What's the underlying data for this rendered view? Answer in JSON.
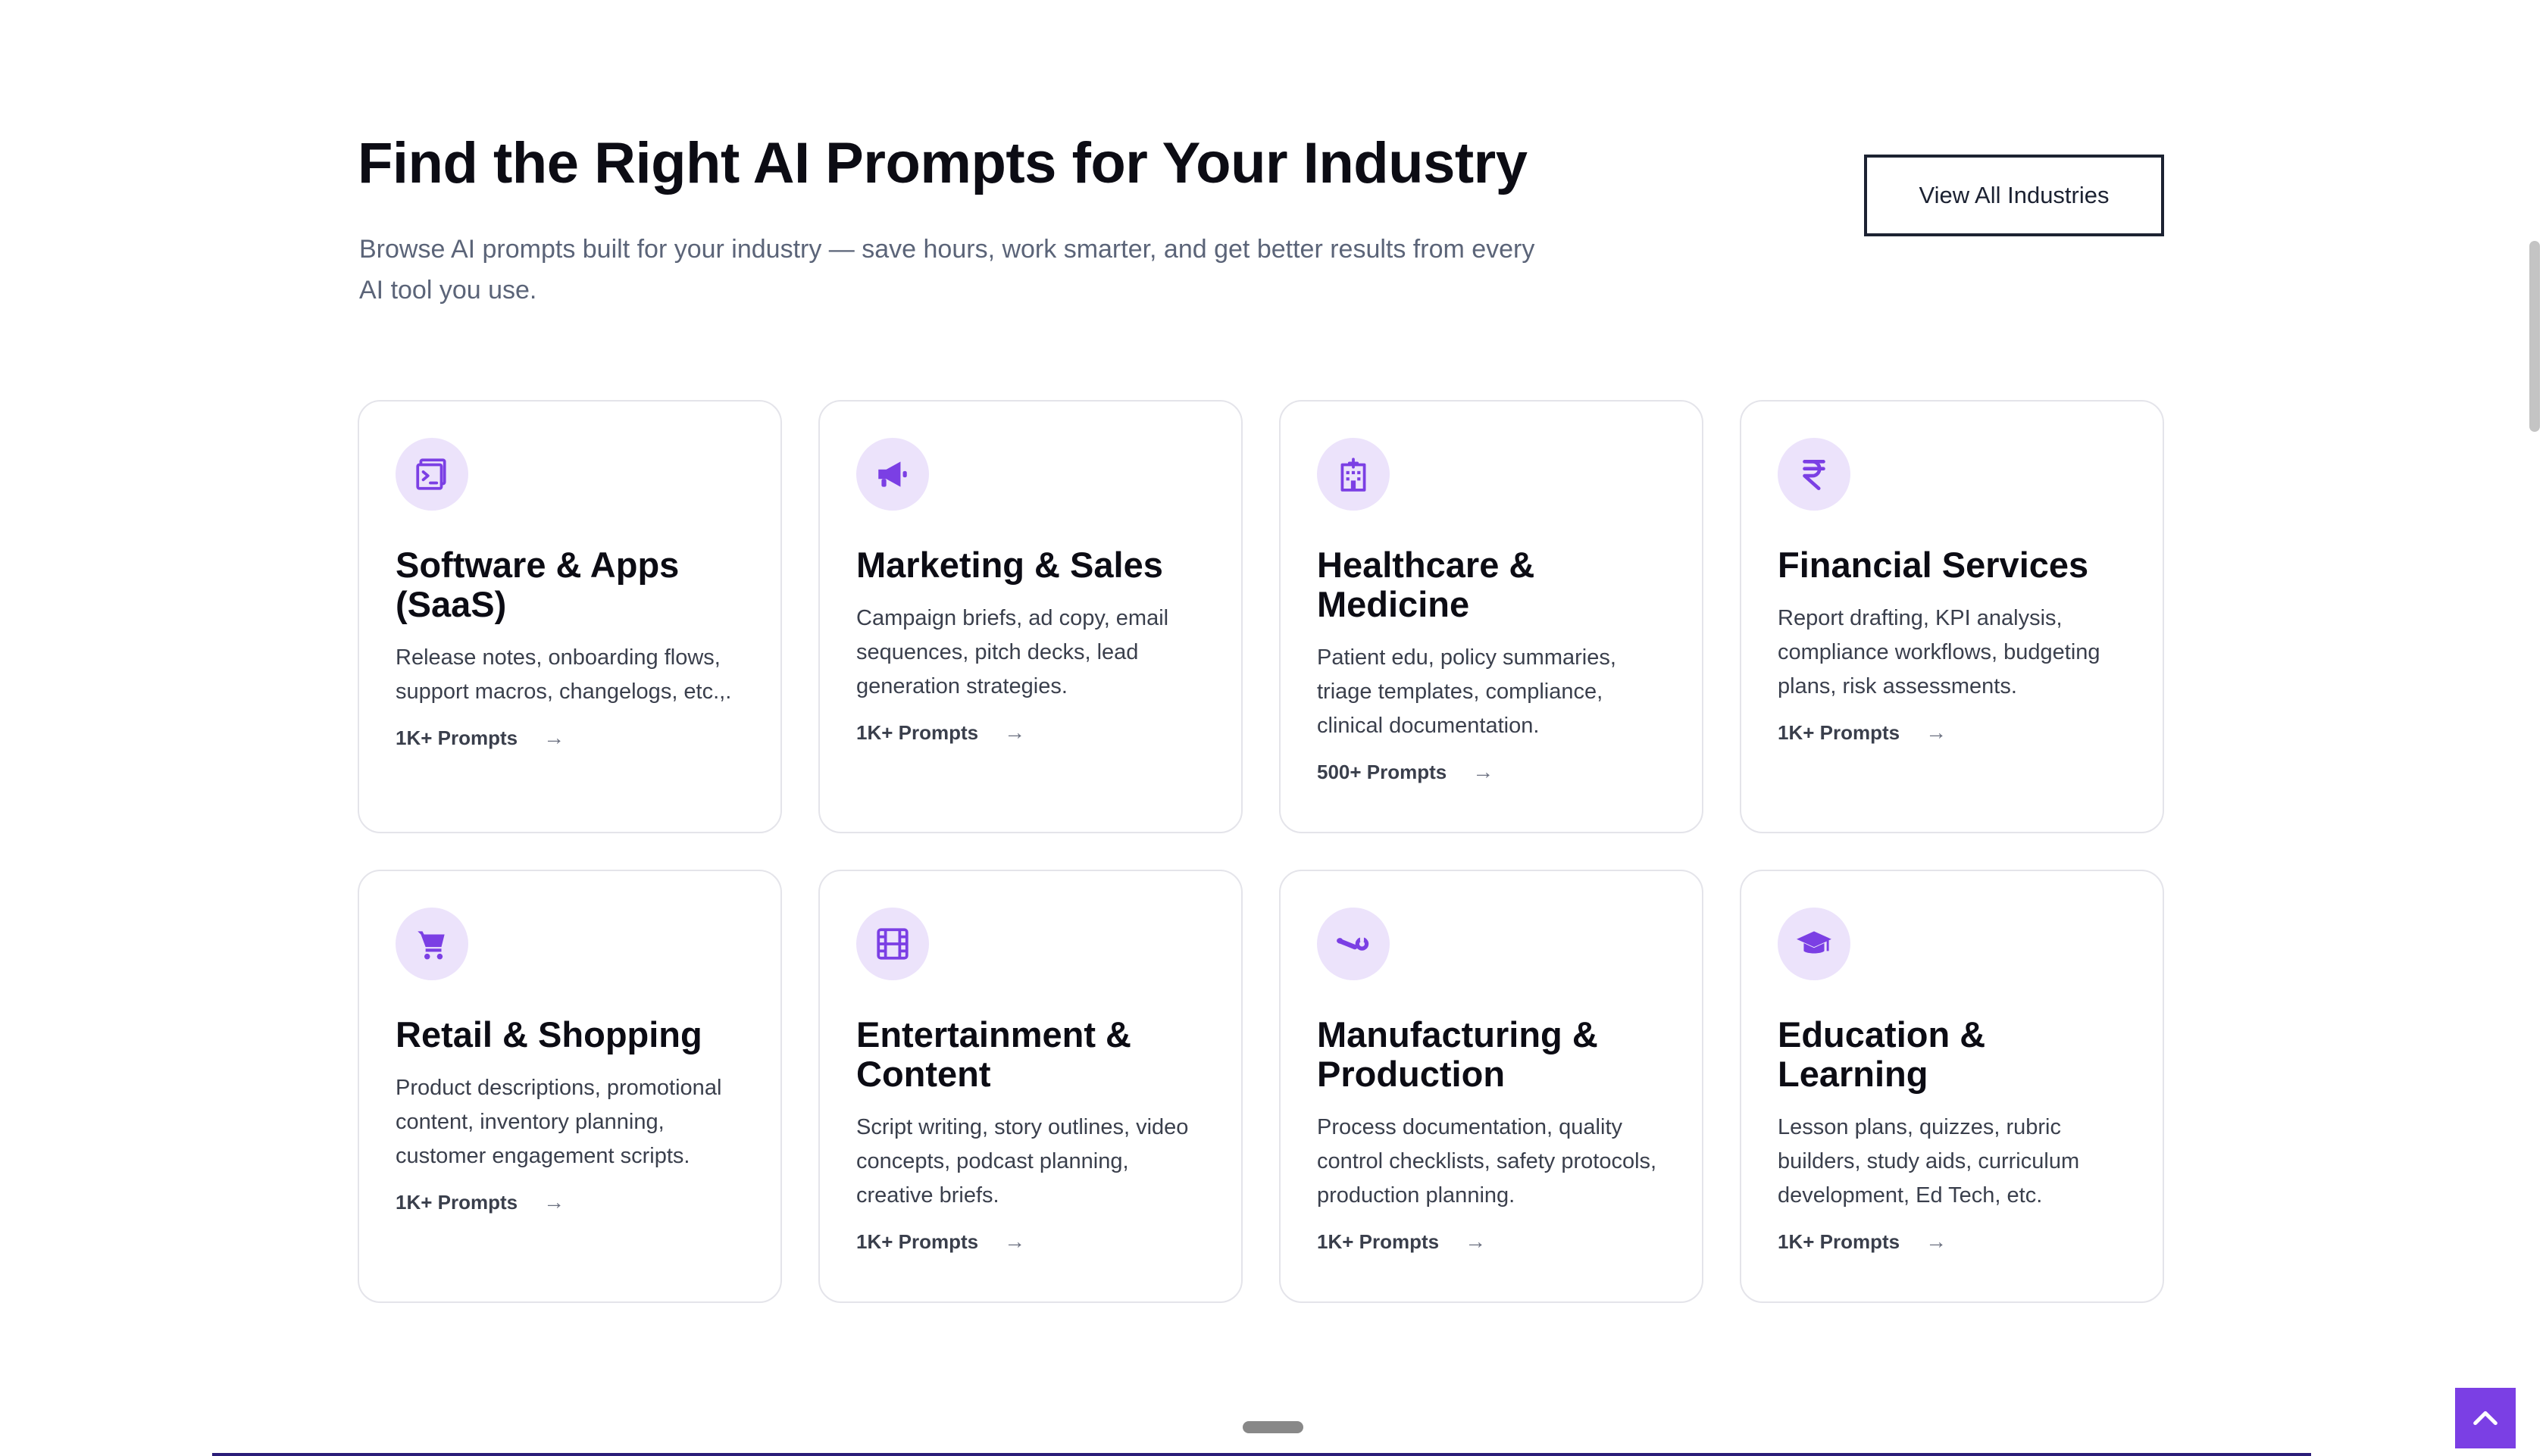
{
  "section": {
    "title": "Find the Right AI Prompts for Your Industry",
    "subtitle": "Browse AI prompts built for your industry — save hours, work smarter, and get better results from every AI tool you use.",
    "view_all_label": "View All Industries"
  },
  "colors": {
    "accent": "#7B3FE4",
    "icon_background": "#ECE3FB",
    "card_border": "#E4E4EA",
    "title_text": "#0C0C14",
    "subtitle_text": "#5B6478",
    "button_border": "#1C2232"
  },
  "industries": [
    {
      "icon": "terminal-window-icon",
      "title": "Software & Apps (SaaS)",
      "description": "Release notes, onboarding flows, support macros, changelogs, etc.,.",
      "prompts_label": "1K+ Prompts"
    },
    {
      "icon": "megaphone-icon",
      "title": "Marketing & Sales",
      "description": "Campaign briefs, ad copy, email sequences, pitch decks, lead generation strategies.",
      "prompts_label": "1K+ Prompts"
    },
    {
      "icon": "hospital-building-icon",
      "title": "Healthcare & Medicine",
      "description": "Patient edu, policy summaries, triage templates, compliance, clinical documentation.",
      "prompts_label": "500+ Prompts"
    },
    {
      "icon": "rupee-icon",
      "title": "Financial Services",
      "description": "Report drafting, KPI analysis, compliance workflows, budgeting plans, risk assessments.",
      "prompts_label": "1K+ Prompts"
    },
    {
      "icon": "shopping-cart-icon",
      "title": "Retail & Shopping",
      "description": "Product descriptions, promotional content, inventory planning, customer engagement scripts.",
      "prompts_label": "1K+ Prompts"
    },
    {
      "icon": "film-strip-icon",
      "title": "Entertainment & Content",
      "description": "Script writing, story outlines, video concepts, podcast planning, creative briefs.",
      "prompts_label": "1K+ Prompts"
    },
    {
      "icon": "wrench-icon",
      "title": "Manufacturing & Production",
      "description": "Process documentation, quality control checklists, safety protocols, production planning.",
      "prompts_label": "1K+ Prompts"
    },
    {
      "icon": "graduation-cap-icon",
      "title": "Education & Learning",
      "description": "Lesson plans, quizzes, rubric builders, study aids, curriculum development, Ed Tech, etc.",
      "prompts_label": "1K+ Prompts"
    }
  ],
  "arrow_icon": "arrow-right-icon",
  "back_to_top_icon": "chevron-up-icon"
}
